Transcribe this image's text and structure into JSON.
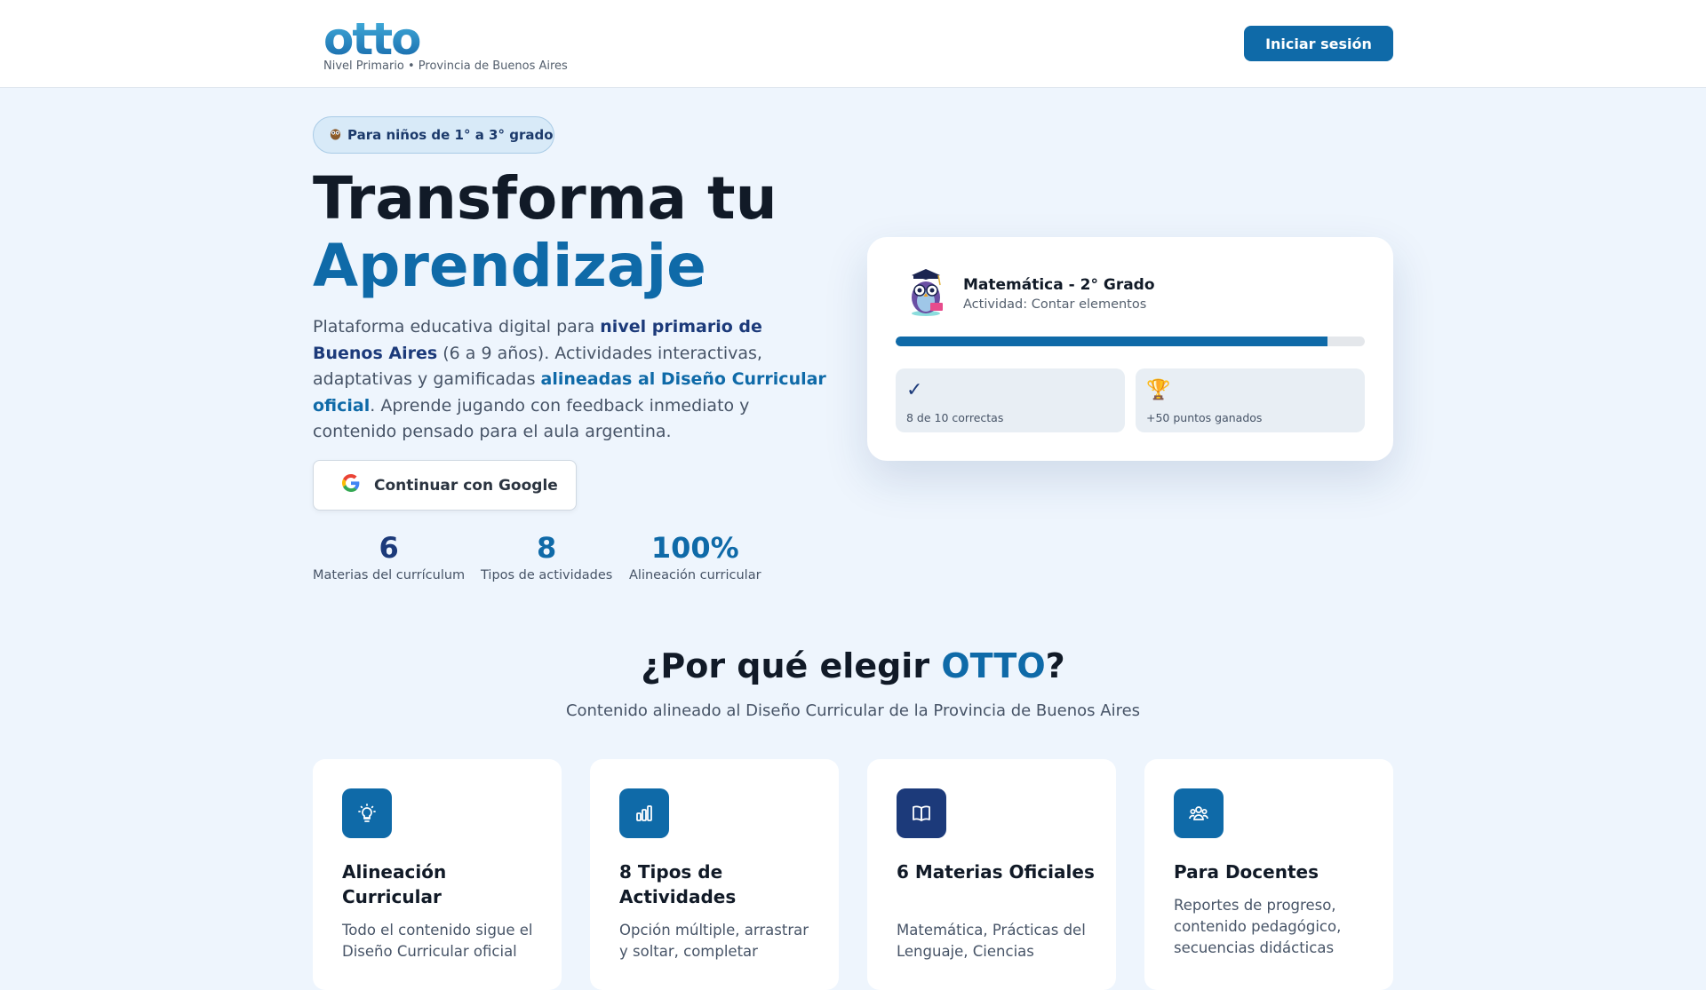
{
  "header": {
    "logo": "otto",
    "subtitle": "Nivel Primario • Provincia de Buenos Aires",
    "login_label": "Iniciar sesión"
  },
  "hero": {
    "badge": "Para niños de 1° a 3° grado",
    "badge_icon": "owl-icon",
    "title_line1": "Transforma tu",
    "title_line2": "Aprendizaje",
    "desc_1": "Plataforma educativa digital para ",
    "desc_bold_1": "nivel primario de Buenos Aires",
    "desc_2": " (6 a 9 años). Actividades interactivas, adaptativas y gamificadas ",
    "desc_bold_2": "alineadas al Diseño Curricular oficial",
    "desc_3": ". Aprende jugando con feedback inmediato y contenido pensado para el aula argentina.",
    "google_label": "Continuar con Google"
  },
  "stats": [
    {
      "value": "6",
      "label": "Materias del currículum",
      "color": "#1c3a7a"
    },
    {
      "value": "8",
      "label": "Tipos de actividades",
      "color": "#0f6aa8"
    },
    {
      "value": "100%",
      "label": "Alineación curricular",
      "color": "#0f6aa8"
    }
  ],
  "activity_card": {
    "title": "Matemática - 2° Grado",
    "subtitle": "Actividad: Contar elementos",
    "progress": 0.92,
    "correct_icon": "✓",
    "correct_text": "8 de 10 correctas",
    "points_icon": "🏆",
    "points_text": "+50 puntos ganados"
  },
  "why": {
    "title_prefix": "¿Por qué elegir ",
    "title_brand": "OTTO",
    "title_suffix": "?",
    "subtitle": "Contenido alineado al Diseño Curricular de la Provincia de Buenos Aires"
  },
  "features": [
    {
      "icon": "lightbulb-icon",
      "color": "#0f6aa8",
      "title": "Alineación Curricular",
      "desc": "Todo el contenido sigue el Diseño Curricular oficial"
    },
    {
      "icon": "bar-chart-icon",
      "color": "#0f6aa8",
      "title": "8 Tipos de Actividades",
      "desc": "Opción múltiple, arrastrar y soltar, completar"
    },
    {
      "icon": "book-icon",
      "color": "#1c3a7a",
      "title": "6 Materias Oficiales",
      "desc": "Matemática, Prácticas del Lenguaje, Ciencias"
    },
    {
      "icon": "users-icon",
      "color": "#0f6aa8",
      "title": "Para Docentes",
      "desc": "Reportes de progreso, contenido pedagógico, secuencias didácticas"
    }
  ]
}
